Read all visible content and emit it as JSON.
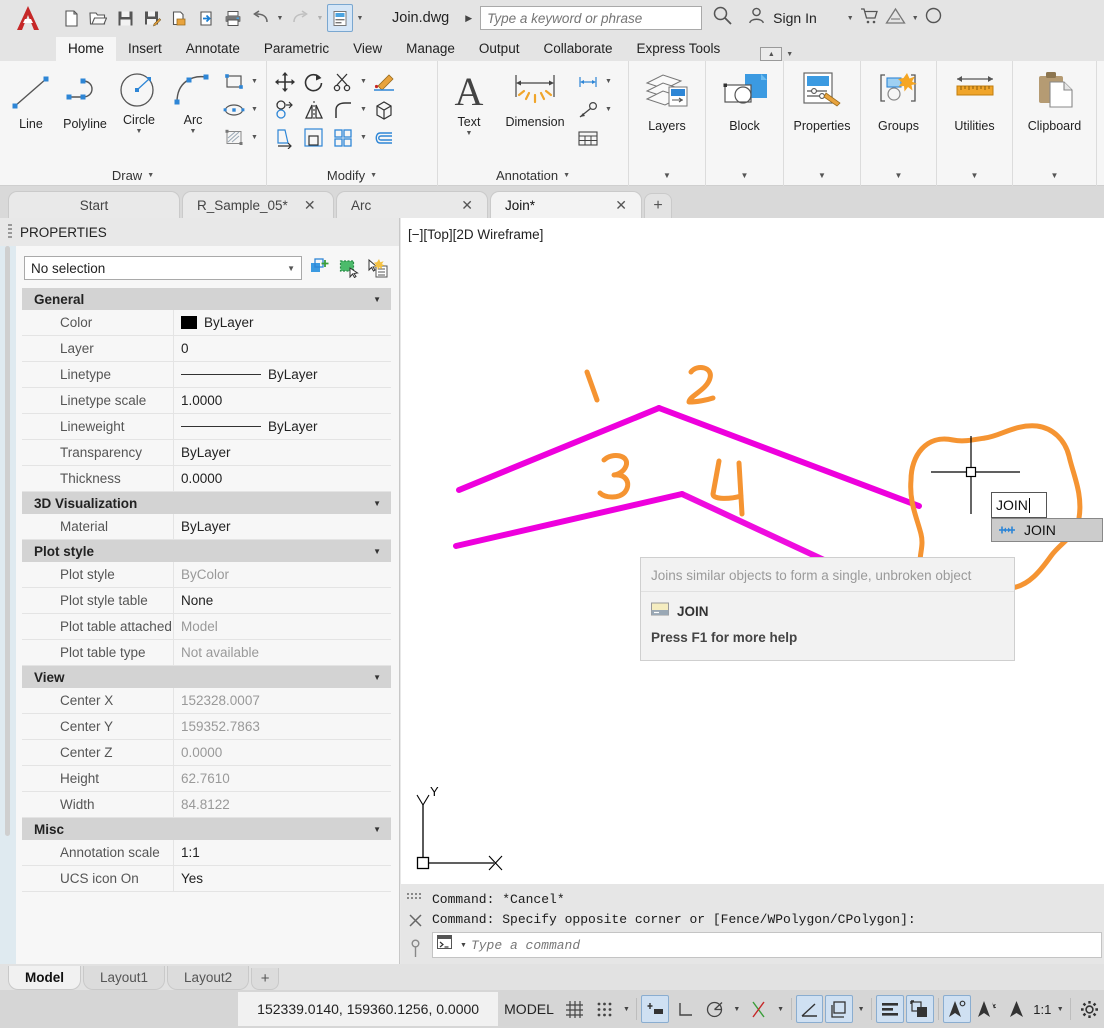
{
  "titlebar": {
    "document_title": "Join.dwg",
    "search_placeholder": "Type a keyword or phrase",
    "signin_label": "Sign In",
    "quick_access": [
      {
        "name": "new-file-icon",
        "label": "New"
      },
      {
        "name": "open-file-icon",
        "label": "Open"
      },
      {
        "name": "save-icon",
        "label": "Save"
      },
      {
        "name": "save-as-icon",
        "label": "Save As"
      },
      {
        "name": "export-icon",
        "label": "Export"
      },
      {
        "name": "import-icon",
        "label": "Import"
      },
      {
        "name": "plot-icon",
        "label": "Plot"
      },
      {
        "name": "undo-icon",
        "label": "Undo"
      },
      {
        "name": "redo-icon",
        "label": "Redo"
      },
      {
        "name": "properties-panel-icon",
        "label": "Properties"
      }
    ]
  },
  "ribbon": {
    "tabs": [
      {
        "label": "Home",
        "selected": true
      },
      {
        "label": "Insert",
        "selected": false
      },
      {
        "label": "Annotate",
        "selected": false
      },
      {
        "label": "Parametric",
        "selected": false
      },
      {
        "label": "View",
        "selected": false
      },
      {
        "label": "Manage",
        "selected": false
      },
      {
        "label": "Output",
        "selected": false
      },
      {
        "label": "Collaborate",
        "selected": false
      },
      {
        "label": "Express Tools",
        "selected": false
      }
    ],
    "panels": [
      {
        "title": "Draw",
        "big_buttons": [
          "Line",
          "Polyline",
          "Circle",
          "Arc"
        ]
      },
      {
        "title": "Modify",
        "big_buttons": []
      },
      {
        "title": "Annotation",
        "big_buttons": [
          "Text",
          "Dimension"
        ]
      },
      {
        "title": "Layers",
        "big_buttons": [
          "Layers"
        ]
      },
      {
        "title": "Block",
        "big_buttons": [
          "Block"
        ]
      },
      {
        "title": "Properties",
        "big_buttons": [
          "Properties"
        ]
      },
      {
        "title": "Groups",
        "big_buttons": [
          "Groups"
        ]
      },
      {
        "title": "Utilities",
        "big_buttons": [
          "Utilities"
        ]
      },
      {
        "title": "Clipboard",
        "big_buttons": [
          "Clipboard"
        ]
      }
    ]
  },
  "file_tabs": [
    {
      "label": "Start",
      "closable": false,
      "selected": false
    },
    {
      "label": "R_Sample_05*",
      "closable": true,
      "selected": false
    },
    {
      "label": "Arc",
      "closable": true,
      "selected": false
    },
    {
      "label": "Join*",
      "closable": true,
      "selected": true
    }
  ],
  "properties": {
    "panel_title": "PROPERTIES",
    "selection": "No selection",
    "groups": [
      {
        "name": "General",
        "rows": [
          {
            "label": "Color",
            "value": "ByLayer",
            "kind": "color",
            "color": "#000000",
            "dim": false
          },
          {
            "label": "Layer",
            "value": "0",
            "kind": "text",
            "dim": false
          },
          {
            "label": "Linetype",
            "value": "ByLayer",
            "kind": "linetype",
            "dim": false
          },
          {
            "label": "Linetype scale",
            "value": "1.0000",
            "kind": "text",
            "dim": false
          },
          {
            "label": "Lineweight",
            "value": "ByLayer",
            "kind": "linetype",
            "dim": false
          },
          {
            "label": "Transparency",
            "value": "ByLayer",
            "kind": "text",
            "dim": false
          },
          {
            "label": "Thickness",
            "value": "0.0000",
            "kind": "text",
            "dim": false
          }
        ]
      },
      {
        "name": "3D Visualization",
        "rows": [
          {
            "label": "Material",
            "value": "ByLayer",
            "kind": "text",
            "dim": false
          }
        ]
      },
      {
        "name": "Plot style",
        "rows": [
          {
            "label": "Plot style",
            "value": "ByColor",
            "kind": "text",
            "dim": true
          },
          {
            "label": "Plot style table",
            "value": "None",
            "kind": "text",
            "dim": false
          },
          {
            "label": "Plot table attached...",
            "value": "Model",
            "kind": "text",
            "dim": true
          },
          {
            "label": "Plot table type",
            "value": "Not available",
            "kind": "text",
            "dim": true
          }
        ]
      },
      {
        "name": "View",
        "rows": [
          {
            "label": "Center X",
            "value": "152328.0007",
            "kind": "text",
            "dim": true
          },
          {
            "label": "Center Y",
            "value": "159352.7863",
            "kind": "text",
            "dim": true
          },
          {
            "label": "Center Z",
            "value": "0.0000",
            "kind": "text",
            "dim": true
          },
          {
            "label": "Height",
            "value": "62.7610",
            "kind": "text",
            "dim": true
          },
          {
            "label": "Width",
            "value": "84.8122",
            "kind": "text",
            "dim": true
          }
        ]
      },
      {
        "name": "Misc",
        "rows": [
          {
            "label": "Annotation scale",
            "value": "1:1",
            "kind": "text",
            "dim": false
          },
          {
            "label": "UCS icon On",
            "value": "Yes",
            "kind": "text",
            "dim": false
          }
        ]
      }
    ]
  },
  "canvas": {
    "viewport_label": "[−][Top][2D Wireframe]",
    "line_color": "#ee00dd",
    "annotation_color": "#f59432",
    "annotations": [
      "1",
      "2",
      "3",
      "4"
    ],
    "ucs_x_label": "X",
    "ucs_y_label": "Y"
  },
  "dynamic_input": {
    "value": "JOIN",
    "suggestion": "JOIN"
  },
  "tooltip": {
    "description": "Joins similar objects to form a single, unbroken object",
    "command": "JOIN",
    "help": "Press F1 for more help"
  },
  "command_line": {
    "history": [
      "Command: *Cancel*",
      "Command: Specify opposite corner or [Fence/WPolygon/CPolygon]:"
    ],
    "placeholder": "Type a command"
  },
  "layout_tabs": [
    {
      "label": "Model",
      "selected": true
    },
    {
      "label": "Layout1",
      "selected": false
    },
    {
      "label": "Layout2",
      "selected": false
    }
  ],
  "status_bar": {
    "coordinates": "152339.0140, 159360.1256, 0.0000",
    "model_label": "MODEL",
    "annotation_scale": "1:1",
    "buttons": [
      {
        "name": "grid-display-icon",
        "on": false
      },
      {
        "name": "snap-mode-icon",
        "on": false
      },
      {
        "name": "ortho-mode-icon",
        "on": true
      },
      {
        "name": "polar-tracking-icon",
        "on": false
      },
      {
        "name": "isometric-drafting-icon",
        "on": false
      },
      {
        "name": "object-snap-tracking-icon",
        "on": false
      },
      {
        "name": "object-snap-icon",
        "on": true
      },
      {
        "name": "lineweight-icon",
        "on": true
      },
      {
        "name": "transparency-icon",
        "on": false
      },
      {
        "name": "selection-cycling-icon",
        "on": false
      },
      {
        "name": "3d-object-snap-icon",
        "on": true
      },
      {
        "name": "dynamic-ucs-icon",
        "on": false
      },
      {
        "name": "annotation-visibility-icon",
        "on": false
      }
    ]
  }
}
